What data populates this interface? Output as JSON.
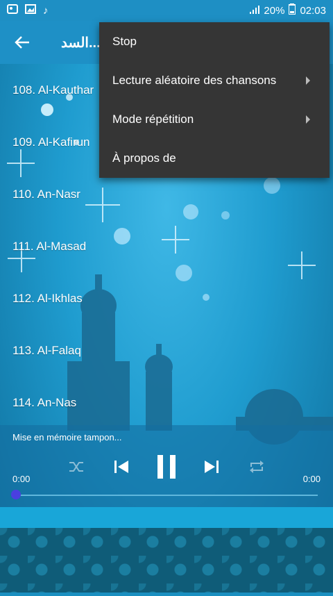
{
  "status": {
    "battery": "20%",
    "time": "02:03"
  },
  "appbar": {
    "title": "السد..."
  },
  "list": {
    "items": [
      "108. Al-Kauthar",
      "109. Al-Kafirun",
      "110. An-Nasr",
      "111. Al-Masad",
      "112. Al-Ikhlas",
      "113. Al-Falaq",
      "114. An-Nas"
    ]
  },
  "menu": {
    "stop": "Stop",
    "shuffle": "Lecture aléatoire des chansons",
    "repeat": "Mode répétition",
    "about": "À propos de"
  },
  "player": {
    "buffering": "Mise en mémoire tampon...",
    "time_current": "0:00",
    "time_total": "0:00",
    "progress": 0
  },
  "colors": {
    "appbar": "#1e90c6",
    "menu_bg": "#353535",
    "seek_thumb": "#4a3fe0"
  }
}
